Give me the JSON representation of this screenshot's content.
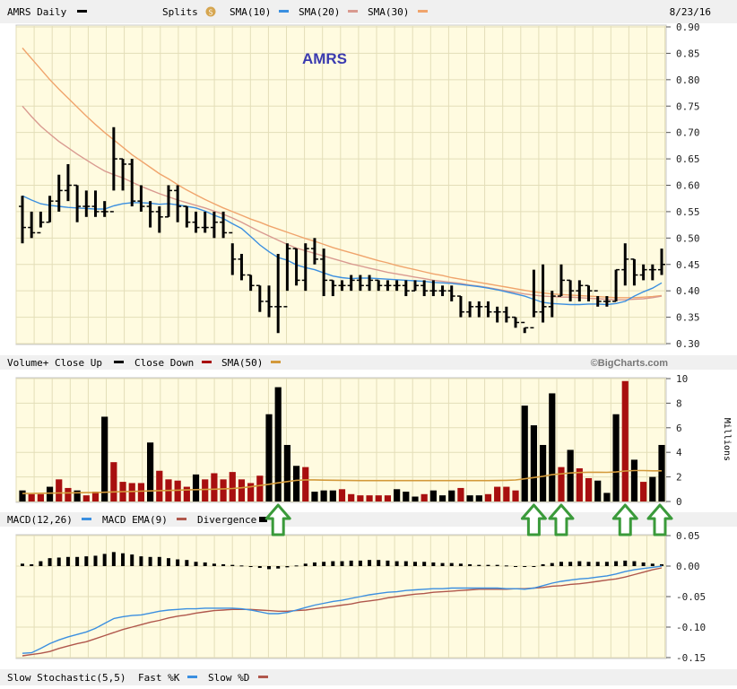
{
  "header": {
    "ticker_label": "AMRS Daily",
    "splits_label": "Splits",
    "sma10_label": "SMA(10)",
    "sma20_label": "SMA(20)",
    "sma30_label": "SMA(30)",
    "date": "8/23/16",
    "watermark": "AMRS"
  },
  "volume_header": {
    "label": "Volume+ Close Up",
    "close_down_label": "Close Down",
    "sma50_label": "SMA(50)",
    "credit": "©BigCharts.com",
    "units": "Millions"
  },
  "macd_header": {
    "label": "MACD(12,26)",
    "ema_label": "MACD EMA(9)",
    "divergence_label": "Divergence"
  },
  "stoch_header": {
    "label": "Slow Stochastic(5,5)",
    "fast_label": "Fast %K",
    "slow_label": "Slow %D"
  },
  "colors": {
    "background": "#ffffff",
    "plot_bg": "#fffbe0",
    "grid": "#e3deb8",
    "header_bg": "#f0f0f0",
    "up": "#000000",
    "down": "#a80f0f",
    "sma10": "#3b8fe0",
    "sma20": "#d99a90",
    "sma30": "#f0a46c",
    "vol_sma": "#d39a3b",
    "macd": "#3b8fe0",
    "macd_ema": "#b0574c",
    "arrow": "#3a9a3a",
    "title": "#3a3ab0"
  },
  "chart_data": [
    {
      "type": "ohlc",
      "name": "price",
      "ylim": [
        0.3,
        0.9
      ],
      "yticks": [
        "0.30",
        "0.35",
        "0.40",
        "0.45",
        "0.50",
        "0.55",
        "0.60",
        "0.65",
        "0.70",
        "0.75",
        "0.80",
        "0.85",
        "0.90"
      ],
      "ohlc": [
        [
          0.56,
          0.58,
          0.49,
          0.52
        ],
        [
          0.52,
          0.55,
          0.5,
          0.51
        ],
        [
          0.51,
          0.55,
          0.52,
          0.53
        ],
        [
          0.53,
          0.58,
          0.53,
          0.57
        ],
        [
          0.57,
          0.62,
          0.55,
          0.59
        ],
        [
          0.59,
          0.64,
          0.57,
          0.6
        ],
        [
          0.6,
          0.6,
          0.53,
          0.56
        ],
        [
          0.56,
          0.59,
          0.54,
          0.56
        ],
        [
          0.56,
          0.59,
          0.54,
          0.55
        ],
        [
          0.55,
          0.57,
          0.54,
          0.55
        ],
        [
          0.55,
          0.71,
          0.59,
          0.65
        ],
        [
          0.65,
          0.65,
          0.59,
          0.64
        ],
        [
          0.64,
          0.65,
          0.56,
          0.57
        ],
        [
          0.57,
          0.6,
          0.55,
          0.56
        ],
        [
          0.56,
          0.57,
          0.52,
          0.55
        ],
        [
          0.55,
          0.56,
          0.51,
          0.54
        ],
        [
          0.54,
          0.6,
          0.54,
          0.59
        ],
        [
          0.59,
          0.6,
          0.53,
          0.56
        ],
        [
          0.56,
          0.56,
          0.52,
          0.53
        ],
        [
          0.53,
          0.55,
          0.51,
          0.52
        ],
        [
          0.52,
          0.55,
          0.51,
          0.52
        ],
        [
          0.52,
          0.55,
          0.5,
          0.53
        ],
        [
          0.53,
          0.55,
          0.5,
          0.51
        ],
        [
          0.51,
          0.49,
          0.43,
          0.46
        ],
        [
          0.46,
          0.47,
          0.42,
          0.43
        ],
        [
          0.43,
          0.43,
          0.4,
          0.41
        ],
        [
          0.41,
          0.41,
          0.36,
          0.38
        ],
        [
          0.38,
          0.41,
          0.35,
          0.37
        ],
        [
          0.37,
          0.47,
          0.32,
          0.37
        ],
        [
          0.37,
          0.49,
          0.4,
          0.48
        ],
        [
          0.48,
          0.48,
          0.41,
          0.42
        ],
        [
          0.42,
          0.49,
          0.4,
          0.48
        ],
        [
          0.48,
          0.5,
          0.45,
          0.46
        ],
        [
          0.46,
          0.48,
          0.39,
          0.42
        ],
        [
          0.42,
          0.42,
          0.39,
          0.41
        ],
        [
          0.41,
          0.42,
          0.4,
          0.41
        ],
        [
          0.41,
          0.43,
          0.4,
          0.42
        ],
        [
          0.42,
          0.43,
          0.4,
          0.41
        ],
        [
          0.41,
          0.43,
          0.4,
          0.42
        ],
        [
          0.42,
          0.42,
          0.4,
          0.41
        ],
        [
          0.41,
          0.42,
          0.4,
          0.41
        ],
        [
          0.41,
          0.42,
          0.4,
          0.41
        ],
        [
          0.41,
          0.42,
          0.39,
          0.4
        ],
        [
          0.4,
          0.42,
          0.4,
          0.41
        ],
        [
          0.41,
          0.42,
          0.39,
          0.4
        ],
        [
          0.4,
          0.42,
          0.39,
          0.4
        ],
        [
          0.4,
          0.41,
          0.39,
          0.4
        ],
        [
          0.4,
          0.41,
          0.38,
          0.39
        ],
        [
          0.39,
          0.39,
          0.35,
          0.36
        ],
        [
          0.36,
          0.38,
          0.35,
          0.37
        ],
        [
          0.37,
          0.38,
          0.35,
          0.37
        ],
        [
          0.37,
          0.38,
          0.35,
          0.36
        ],
        [
          0.36,
          0.37,
          0.34,
          0.36
        ],
        [
          0.36,
          0.37,
          0.34,
          0.35
        ],
        [
          0.35,
          0.35,
          0.33,
          0.34
        ],
        [
          0.34,
          0.33,
          0.32,
          0.33
        ],
        [
          0.33,
          0.44,
          0.35,
          0.36
        ],
        [
          0.36,
          0.45,
          0.34,
          0.37
        ],
        [
          0.37,
          0.4,
          0.35,
          0.39
        ],
        [
          0.39,
          0.45,
          0.39,
          0.42
        ],
        [
          0.42,
          0.42,
          0.38,
          0.4
        ],
        [
          0.4,
          0.42,
          0.38,
          0.41
        ],
        [
          0.41,
          0.41,
          0.38,
          0.4
        ],
        [
          0.4,
          0.39,
          0.37,
          0.38
        ],
        [
          0.38,
          0.39,
          0.37,
          0.38
        ],
        [
          0.38,
          0.44,
          0.38,
          0.44
        ],
        [
          0.44,
          0.49,
          0.41,
          0.46
        ],
        [
          0.46,
          0.46,
          0.41,
          0.43
        ],
        [
          0.43,
          0.45,
          0.42,
          0.44
        ],
        [
          0.44,
          0.45,
          0.42,
          0.44
        ],
        [
          0.44,
          0.48,
          0.43,
          0.45
        ]
      ],
      "series": [
        {
          "name": "SMA(10)",
          "values": [
            0.58,
            0.572,
            0.565,
            0.562,
            0.56,
            0.558,
            0.557,
            0.556,
            0.555,
            0.555,
            0.561,
            0.565,
            0.567,
            0.567,
            0.566,
            0.564,
            0.565,
            0.563,
            0.56,
            0.557,
            0.551,
            0.543,
            0.537,
            0.527,
            0.518,
            0.503,
            0.487,
            0.474,
            0.463,
            0.458,
            0.449,
            0.444,
            0.44,
            0.434,
            0.428,
            0.425,
            0.423,
            0.424,
            0.424,
            0.423,
            0.422,
            0.421,
            0.42,
            0.419,
            0.418,
            0.416,
            0.415,
            0.414,
            0.412,
            0.41,
            0.408,
            0.405,
            0.402,
            0.398,
            0.394,
            0.39,
            0.384,
            0.378,
            0.376,
            0.375,
            0.374,
            0.374,
            0.375,
            0.375,
            0.374,
            0.376,
            0.38,
            0.39,
            0.398,
            0.405,
            0.415
          ]
        },
        {
          "name": "SMA(20)",
          "values": [
            0.75,
            0.73,
            0.712,
            0.697,
            0.683,
            0.671,
            0.659,
            0.648,
            0.637,
            0.627,
            0.62,
            0.614,
            0.606,
            0.598,
            0.591,
            0.584,
            0.578,
            0.572,
            0.567,
            0.562,
            0.557,
            0.551,
            0.545,
            0.538,
            0.53,
            0.521,
            0.512,
            0.504,
            0.496,
            0.488,
            0.481,
            0.476,
            0.471,
            0.466,
            0.461,
            0.456,
            0.451,
            0.447,
            0.443,
            0.439,
            0.435,
            0.432,
            0.429,
            0.426,
            0.423,
            0.42,
            0.418,
            0.416,
            0.414,
            0.411,
            0.409,
            0.406,
            0.403,
            0.4,
            0.397,
            0.394,
            0.392,
            0.39,
            0.389,
            0.388,
            0.388,
            0.387,
            0.386,
            0.385,
            0.384,
            0.383,
            0.383,
            0.384,
            0.385,
            0.387,
            0.39
          ]
        },
        {
          "name": "SMA(30)",
          "values": [
            0.86,
            0.84,
            0.82,
            0.8,
            0.782,
            0.765,
            0.748,
            0.731,
            0.715,
            0.7,
            0.686,
            0.672,
            0.658,
            0.646,
            0.634,
            0.622,
            0.612,
            0.601,
            0.591,
            0.582,
            0.573,
            0.565,
            0.557,
            0.55,
            0.543,
            0.536,
            0.53,
            0.523,
            0.517,
            0.511,
            0.505,
            0.499,
            0.494,
            0.488,
            0.482,
            0.477,
            0.472,
            0.467,
            0.462,
            0.457,
            0.453,
            0.448,
            0.444,
            0.44,
            0.436,
            0.432,
            0.429,
            0.425,
            0.422,
            0.419,
            0.416,
            0.413,
            0.41,
            0.407,
            0.404,
            0.401,
            0.398,
            0.396,
            0.394,
            0.393,
            0.392,
            0.391,
            0.39,
            0.389,
            0.388,
            0.387,
            0.387,
            0.387,
            0.388,
            0.389,
            0.391
          ]
        }
      ]
    },
    {
      "type": "bar",
      "name": "volume",
      "ylim": [
        0,
        10
      ],
      "yticks": [
        "0",
        "2",
        "4",
        "6",
        "8",
        "10"
      ],
      "ylabel": "Millions",
      "values": [
        0.9,
        0.6,
        0.6,
        1.2,
        1.8,
        1.1,
        0.9,
        0.5,
        0.8,
        6.9,
        3.2,
        1.6,
        1.5,
        1.5,
        4.8,
        2.5,
        1.8,
        1.7,
        1.2,
        2.2,
        1.8,
        2.3,
        1.8,
        2.4,
        1.8,
        1.5,
        2.1,
        7.1,
        9.3,
        4.6,
        2.9,
        2.8,
        0.8,
        0.9,
        0.9,
        1.0,
        0.6,
        0.5,
        0.5,
        0.5,
        0.5,
        1.0,
        0.8,
        0.4,
        0.6,
        0.9,
        0.5,
        0.9,
        1.1,
        0.5,
        0.5,
        0.6,
        1.2,
        1.2,
        0.9,
        7.8,
        6.2,
        4.6,
        8.8,
        2.8,
        4.2,
        2.7,
        1.9,
        1.7,
        0.7,
        7.1,
        9.8,
        3.4,
        1.6,
        2.0,
        4.6
      ],
      "up": [
        true,
        false,
        false,
        true,
        false,
        false,
        true,
        false,
        false,
        true,
        false,
        false,
        false,
        false,
        true,
        false,
        false,
        false,
        false,
        true,
        false,
        false,
        false,
        false,
        false,
        false,
        false,
        true,
        true,
        true,
        true,
        false,
        true,
        true,
        true,
        false,
        false,
        false,
        false,
        false,
        false,
        true,
        true,
        true,
        false,
        true,
        true,
        true,
        false,
        true,
        true,
        false,
        false,
        false,
        false,
        true,
        true,
        true,
        true,
        false,
        true,
        false,
        false,
        true,
        true,
        true,
        false,
        true,
        false,
        true,
        true
      ],
      "series": [
        {
          "name": "SMA(50)",
          "values": [
            0.65,
            0.66,
            0.67,
            0.68,
            0.69,
            0.7,
            0.71,
            0.72,
            0.73,
            0.75,
            0.78,
            0.8,
            0.82,
            0.84,
            0.86,
            0.88,
            0.9,
            0.92,
            0.94,
            0.96,
            0.98,
            1.0,
            1.03,
            1.06,
            1.12,
            1.2,
            1.3,
            1.4,
            1.52,
            1.62,
            1.72,
            1.76,
            1.76,
            1.74,
            1.73,
            1.72,
            1.71,
            1.7,
            1.7,
            1.7,
            1.7,
            1.7,
            1.7,
            1.7,
            1.7,
            1.7,
            1.7,
            1.7,
            1.7,
            1.7,
            1.7,
            1.7,
            1.71,
            1.72,
            1.75,
            1.85,
            1.95,
            2.05,
            2.18,
            2.25,
            2.32,
            2.36,
            2.38,
            2.38,
            2.37,
            2.4,
            2.48,
            2.52,
            2.52,
            2.5,
            2.5
          ]
        }
      ]
    },
    {
      "type": "line",
      "name": "macd",
      "ylim": [
        -0.15,
        0.05
      ],
      "yticks": [
        "-0.15",
        "-0.10",
        "-0.05",
        "0.00",
        "0.05"
      ],
      "series": [
        {
          "name": "MACD(12,26)",
          "values": [
            -0.143,
            -0.142,
            -0.135,
            -0.127,
            -0.121,
            -0.116,
            -0.112,
            -0.108,
            -0.102,
            -0.094,
            -0.086,
            -0.083,
            -0.081,
            -0.08,
            -0.077,
            -0.074,
            -0.072,
            -0.071,
            -0.07,
            -0.07,
            -0.069,
            -0.069,
            -0.069,
            -0.069,
            -0.07,
            -0.072,
            -0.075,
            -0.078,
            -0.078,
            -0.076,
            -0.072,
            -0.068,
            -0.064,
            -0.061,
            -0.058,
            -0.056,
            -0.053,
            -0.05,
            -0.047,
            -0.045,
            -0.043,
            -0.042,
            -0.04,
            -0.039,
            -0.038,
            -0.037,
            -0.037,
            -0.036,
            -0.036,
            -0.036,
            -0.036,
            -0.036,
            -0.036,
            -0.037,
            -0.037,
            -0.038,
            -0.036,
            -0.032,
            -0.028,
            -0.025,
            -0.023,
            -0.021,
            -0.02,
            -0.018,
            -0.016,
            -0.013,
            -0.009,
            -0.006,
            -0.004,
            -0.002,
            0.0
          ]
        },
        {
          "name": "MACD EMA(9)",
          "values": [
            -0.147,
            -0.145,
            -0.143,
            -0.14,
            -0.135,
            -0.131,
            -0.127,
            -0.124,
            -0.119,
            -0.114,
            -0.109,
            -0.104,
            -0.1,
            -0.096,
            -0.092,
            -0.089,
            -0.085,
            -0.082,
            -0.08,
            -0.077,
            -0.075,
            -0.073,
            -0.072,
            -0.071,
            -0.071,
            -0.071,
            -0.072,
            -0.073,
            -0.074,
            -0.074,
            -0.073,
            -0.072,
            -0.07,
            -0.068,
            -0.066,
            -0.064,
            -0.062,
            -0.059,
            -0.057,
            -0.055,
            -0.052,
            -0.05,
            -0.048,
            -0.046,
            -0.045,
            -0.043,
            -0.042,
            -0.041,
            -0.04,
            -0.039,
            -0.038,
            -0.038,
            -0.038,
            -0.038,
            -0.037,
            -0.037,
            -0.036,
            -0.035,
            -0.033,
            -0.032,
            -0.03,
            -0.029,
            -0.027,
            -0.025,
            -0.023,
            -0.021,
            -0.018,
            -0.014,
            -0.01,
            -0.006,
            -0.003
          ]
        }
      ],
      "divergence": [
        0.004,
        0.003,
        0.008,
        0.013,
        0.014,
        0.015,
        0.015,
        0.016,
        0.017,
        0.02,
        0.023,
        0.021,
        0.019,
        0.016,
        0.015,
        0.015,
        0.013,
        0.011,
        0.01,
        0.007,
        0.006,
        0.004,
        0.003,
        0.002,
        0.001,
        -0.001,
        -0.003,
        -0.005,
        -0.004,
        -0.002,
        0.001,
        0.004,
        0.006,
        0.007,
        0.008,
        0.008,
        0.009,
        0.009,
        0.01,
        0.01,
        0.009,
        0.008,
        0.008,
        0.007,
        0.007,
        0.006,
        0.005,
        0.005,
        0.004,
        0.003,
        0.002,
        0.002,
        0.002,
        0.001,
        0.0,
        -0.001,
        0.0,
        0.003,
        0.005,
        0.007,
        0.007,
        0.008,
        0.007,
        0.007,
        0.007,
        0.008,
        0.009,
        0.008,
        0.006,
        0.004,
        0.003
      ]
    }
  ],
  "arrows_at": [
    28,
    56,
    59,
    66,
    72
  ]
}
